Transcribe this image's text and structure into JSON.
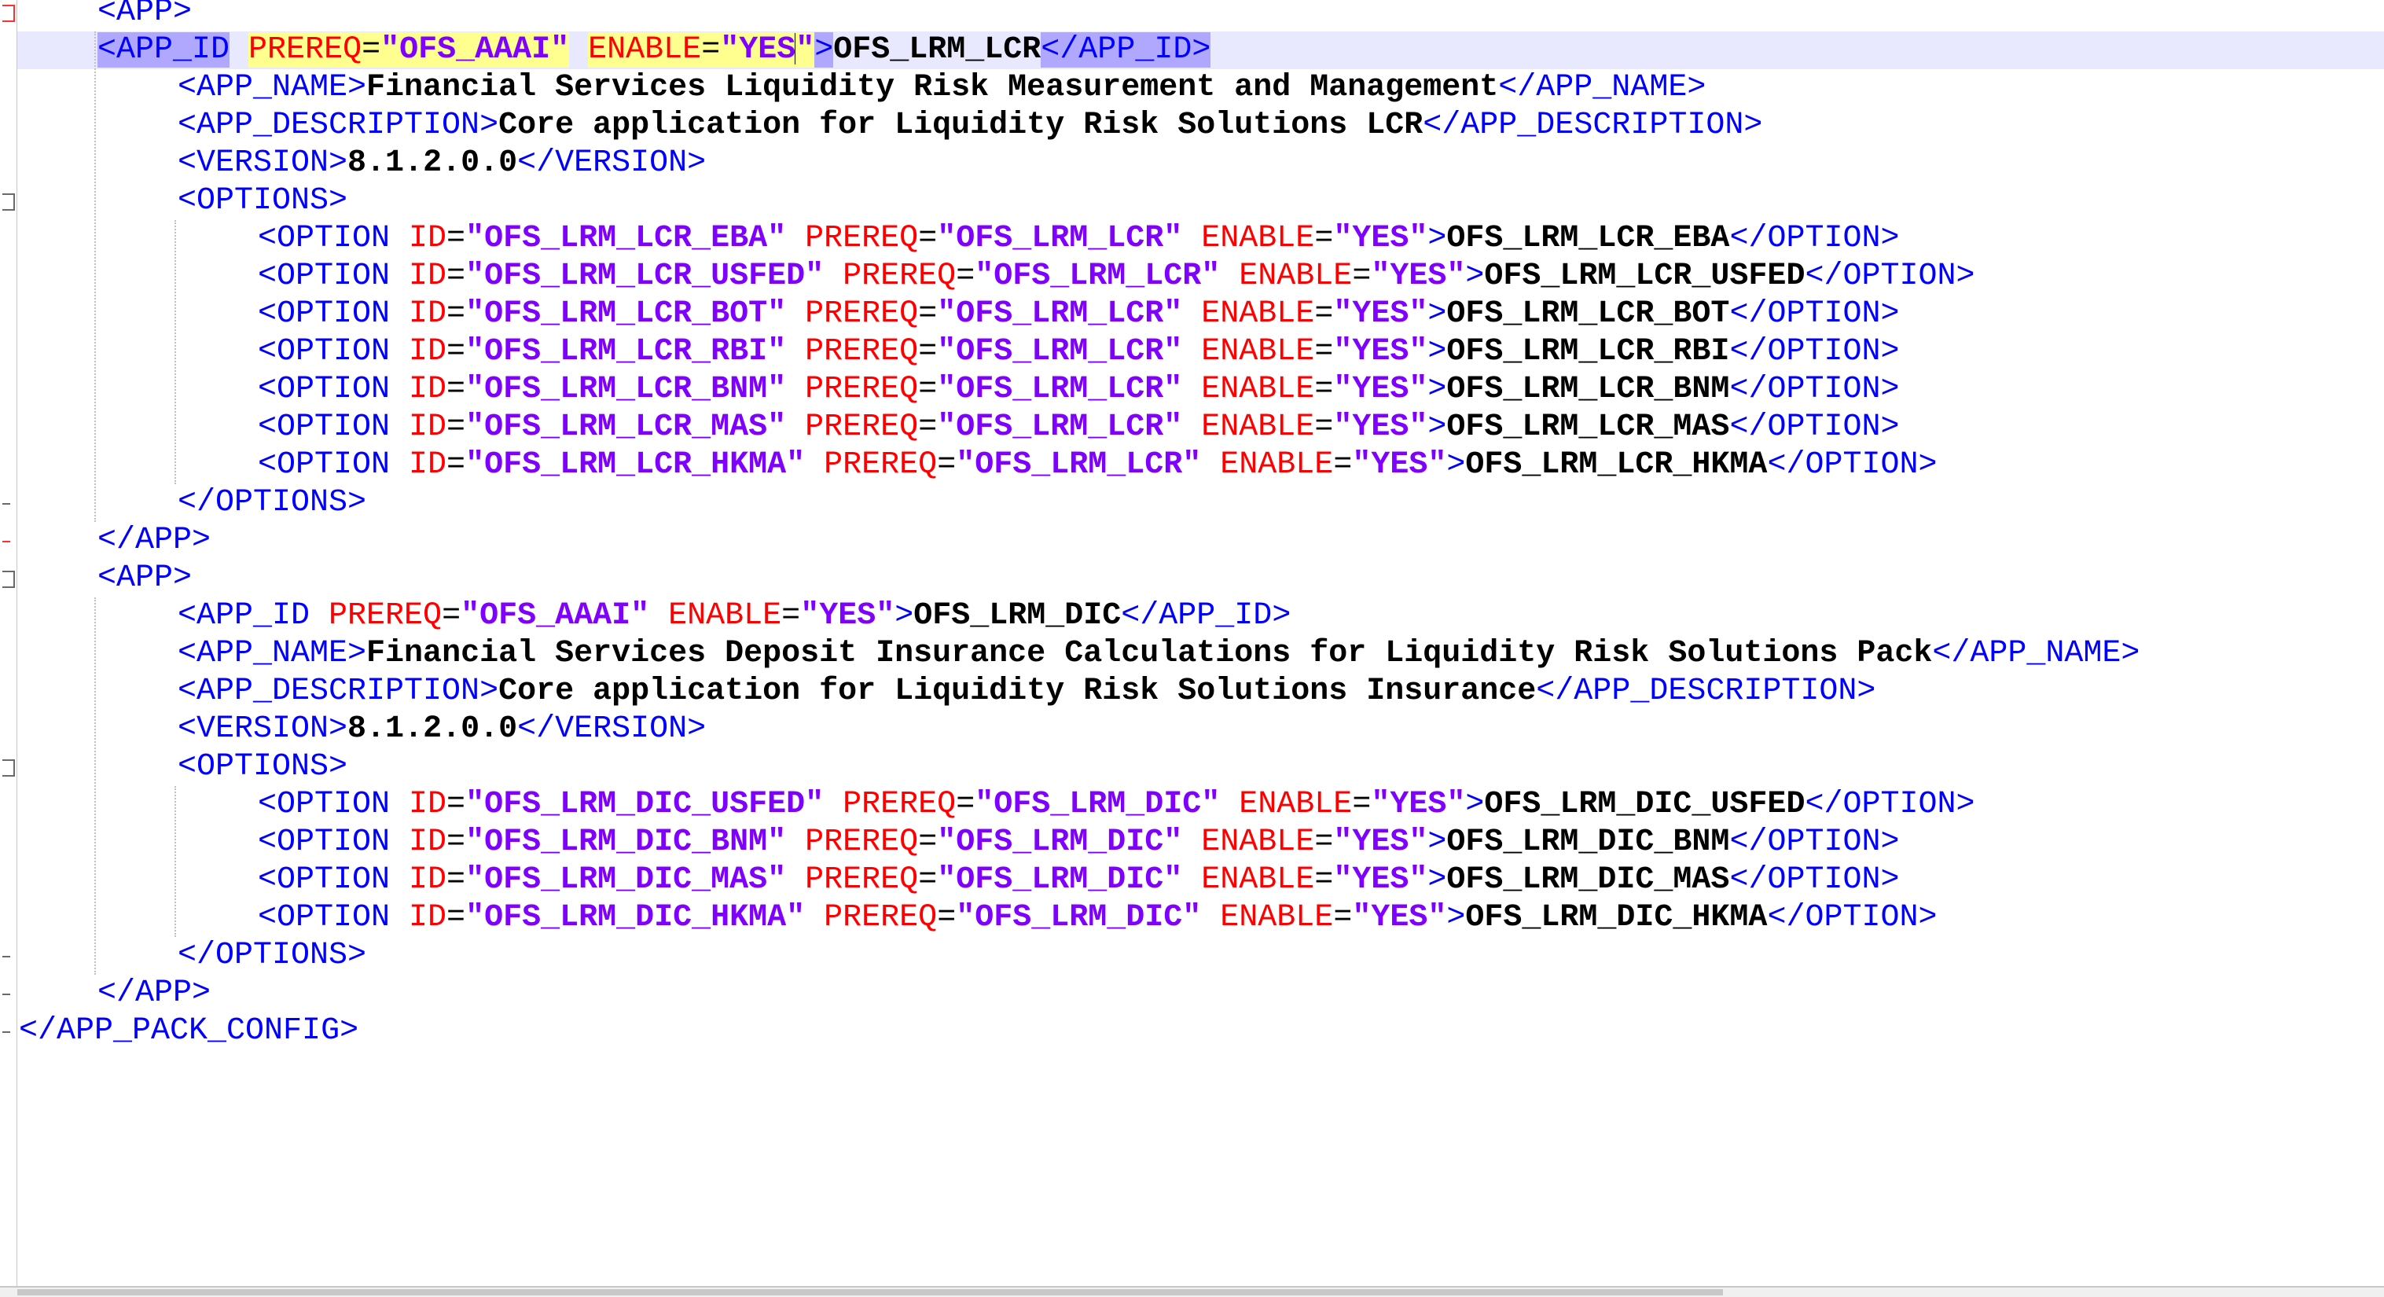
{
  "editor": {
    "lines": [
      [
        {
          "t": "<APP>",
          "c": "tag"
        }
      ],
      [
        {
          "t": "<APP_ID",
          "c": "tag hl-match"
        },
        {
          "t": " ",
          "c": "tag"
        },
        {
          "t": "PREREQ",
          "c": "attr hl-attr"
        },
        {
          "t": "=",
          "c": "eq hl-attr"
        },
        {
          "t": "\"OFS_AAAI\"",
          "c": "val hl-attr"
        },
        {
          "t": " ",
          "c": "tag"
        },
        {
          "t": "ENABLE",
          "c": "attr hl-attr"
        },
        {
          "t": "=",
          "c": "eq hl-attr"
        },
        {
          "t": "\"YES",
          "c": "val hl-attr"
        },
        {
          "caret": true
        },
        {
          "t": "\"",
          "c": "val hl-attr"
        },
        {
          "t": ">",
          "c": "tag hl-match"
        },
        {
          "t": "OFS_LRM_LCR",
          "c": "content"
        },
        {
          "t": "</APP_ID>",
          "c": "tag hl-match"
        }
      ],
      [
        {
          "t": "<APP_NAME>",
          "c": "tag"
        },
        {
          "t": "Financial Services Liquidity Risk Measurement and Management",
          "c": "content"
        },
        {
          "t": "</APP_NAME>",
          "c": "tag"
        }
      ],
      [
        {
          "t": "<APP_DESCRIPTION>",
          "c": "tag"
        },
        {
          "t": "Core application for Liquidity Risk Solutions LCR",
          "c": "content"
        },
        {
          "t": "</APP_DESCRIPTION>",
          "c": "tag"
        }
      ],
      [
        {
          "t": "<VERSION>",
          "c": "tag"
        },
        {
          "t": "8.1.2.0.0",
          "c": "content"
        },
        {
          "t": "</VERSION>",
          "c": "tag"
        }
      ],
      [
        {
          "t": "<OPTIONS>",
          "c": "tag"
        }
      ],
      [
        {
          "t": "<OPTION ",
          "c": "tag"
        },
        {
          "t": "ID",
          "c": "attr"
        },
        {
          "t": "=",
          "c": "eq"
        },
        {
          "t": "\"OFS_LRM_LCR_EBA\"",
          "c": "val"
        },
        {
          "t": " ",
          "c": "tag"
        },
        {
          "t": "PREREQ",
          "c": "attr"
        },
        {
          "t": "=",
          "c": "eq"
        },
        {
          "t": "\"OFS_LRM_LCR\"",
          "c": "val"
        },
        {
          "t": " ",
          "c": "tag"
        },
        {
          "t": "ENABLE",
          "c": "attr"
        },
        {
          "t": "=",
          "c": "eq"
        },
        {
          "t": "\"YES\"",
          "c": "val"
        },
        {
          "t": ">",
          "c": "tag"
        },
        {
          "t": "OFS_LRM_LCR_EBA",
          "c": "content"
        },
        {
          "t": "</OPTION>",
          "c": "tag"
        }
      ],
      [
        {
          "t": "<OPTION ",
          "c": "tag"
        },
        {
          "t": "ID",
          "c": "attr"
        },
        {
          "t": "=",
          "c": "eq"
        },
        {
          "t": "\"OFS_LRM_LCR_USFED\"",
          "c": "val"
        },
        {
          "t": " ",
          "c": "tag"
        },
        {
          "t": "PREREQ",
          "c": "attr"
        },
        {
          "t": "=",
          "c": "eq"
        },
        {
          "t": "\"OFS_LRM_LCR\"",
          "c": "val"
        },
        {
          "t": " ",
          "c": "tag"
        },
        {
          "t": "ENABLE",
          "c": "attr"
        },
        {
          "t": "=",
          "c": "eq"
        },
        {
          "t": "\"YES\"",
          "c": "val"
        },
        {
          "t": ">",
          "c": "tag"
        },
        {
          "t": "OFS_LRM_LCR_USFED",
          "c": "content"
        },
        {
          "t": "</OPTION>",
          "c": "tag"
        }
      ],
      [
        {
          "t": "<OPTION ",
          "c": "tag"
        },
        {
          "t": "ID",
          "c": "attr"
        },
        {
          "t": "=",
          "c": "eq"
        },
        {
          "t": "\"OFS_LRM_LCR_BOT\"",
          "c": "val"
        },
        {
          "t": " ",
          "c": "tag"
        },
        {
          "t": "PREREQ",
          "c": "attr"
        },
        {
          "t": "=",
          "c": "eq"
        },
        {
          "t": "\"OFS_LRM_LCR\"",
          "c": "val"
        },
        {
          "t": " ",
          "c": "tag"
        },
        {
          "t": "ENABLE",
          "c": "attr"
        },
        {
          "t": "=",
          "c": "eq"
        },
        {
          "t": "\"YES\"",
          "c": "val"
        },
        {
          "t": ">",
          "c": "tag"
        },
        {
          "t": "OFS_LRM_LCR_BOT",
          "c": "content"
        },
        {
          "t": "</OPTION>",
          "c": "tag"
        }
      ],
      [
        {
          "t": "<OPTION ",
          "c": "tag"
        },
        {
          "t": "ID",
          "c": "attr"
        },
        {
          "t": "=",
          "c": "eq"
        },
        {
          "t": "\"OFS_LRM_LCR_RBI\"",
          "c": "val"
        },
        {
          "t": " ",
          "c": "tag"
        },
        {
          "t": "PREREQ",
          "c": "attr"
        },
        {
          "t": "=",
          "c": "eq"
        },
        {
          "t": "\"OFS_LRM_LCR\"",
          "c": "val"
        },
        {
          "t": " ",
          "c": "tag"
        },
        {
          "t": "ENABLE",
          "c": "attr"
        },
        {
          "t": "=",
          "c": "eq"
        },
        {
          "t": "\"YES\"",
          "c": "val"
        },
        {
          "t": ">",
          "c": "tag"
        },
        {
          "t": "OFS_LRM_LCR_RBI",
          "c": "content"
        },
        {
          "t": "</OPTION>",
          "c": "tag"
        }
      ],
      [
        {
          "t": "<OPTION ",
          "c": "tag"
        },
        {
          "t": "ID",
          "c": "attr"
        },
        {
          "t": "=",
          "c": "eq"
        },
        {
          "t": "\"OFS_LRM_LCR_BNM\"",
          "c": "val"
        },
        {
          "t": " ",
          "c": "tag"
        },
        {
          "t": "PREREQ",
          "c": "attr"
        },
        {
          "t": "=",
          "c": "eq"
        },
        {
          "t": "\"OFS_LRM_LCR\"",
          "c": "val"
        },
        {
          "t": " ",
          "c": "tag"
        },
        {
          "t": "ENABLE",
          "c": "attr"
        },
        {
          "t": "=",
          "c": "eq"
        },
        {
          "t": "\"YES\"",
          "c": "val"
        },
        {
          "t": ">",
          "c": "tag"
        },
        {
          "t": "OFS_LRM_LCR_BNM",
          "c": "content"
        },
        {
          "t": "</OPTION>",
          "c": "tag"
        }
      ],
      [
        {
          "t": "<OPTION ",
          "c": "tag"
        },
        {
          "t": "ID",
          "c": "attr"
        },
        {
          "t": "=",
          "c": "eq"
        },
        {
          "t": "\"OFS_LRM_LCR_MAS\"",
          "c": "val"
        },
        {
          "t": " ",
          "c": "tag"
        },
        {
          "t": "PREREQ",
          "c": "attr"
        },
        {
          "t": "=",
          "c": "eq"
        },
        {
          "t": "\"OFS_LRM_LCR\"",
          "c": "val"
        },
        {
          "t": " ",
          "c": "tag"
        },
        {
          "t": "ENABLE",
          "c": "attr"
        },
        {
          "t": "=",
          "c": "eq"
        },
        {
          "t": "\"YES\"",
          "c": "val"
        },
        {
          "t": ">",
          "c": "tag"
        },
        {
          "t": "OFS_LRM_LCR_MAS",
          "c": "content"
        },
        {
          "t": "</OPTION>",
          "c": "tag"
        }
      ],
      [
        {
          "t": "<OPTION ",
          "c": "tag"
        },
        {
          "t": "ID",
          "c": "attr"
        },
        {
          "t": "=",
          "c": "eq"
        },
        {
          "t": "\"OFS_LRM_LCR_HKMA\"",
          "c": "val"
        },
        {
          "t": " ",
          "c": "tag"
        },
        {
          "t": "PREREQ",
          "c": "attr"
        },
        {
          "t": "=",
          "c": "eq"
        },
        {
          "t": "\"OFS_LRM_LCR\"",
          "c": "val"
        },
        {
          "t": " ",
          "c": "tag"
        },
        {
          "t": "ENABLE",
          "c": "attr"
        },
        {
          "t": "=",
          "c": "eq"
        },
        {
          "t": "\"YES\"",
          "c": "val"
        },
        {
          "t": ">",
          "c": "tag"
        },
        {
          "t": "OFS_LRM_LCR_HKMA",
          "c": "content"
        },
        {
          "t": "</OPTION>",
          "c": "tag"
        }
      ],
      [
        {
          "t": "</OPTIONS>",
          "c": "tag"
        }
      ],
      [
        {
          "t": "</APP>",
          "c": "tag"
        }
      ],
      [
        {
          "t": "<APP>",
          "c": "tag"
        }
      ],
      [
        {
          "t": "<APP_ID ",
          "c": "tag"
        },
        {
          "t": "PREREQ",
          "c": "attr"
        },
        {
          "t": "=",
          "c": "eq"
        },
        {
          "t": "\"OFS_AAAI\"",
          "c": "val"
        },
        {
          "t": " ",
          "c": "tag"
        },
        {
          "t": "ENABLE",
          "c": "attr"
        },
        {
          "t": "=",
          "c": "eq"
        },
        {
          "t": "\"YES\"",
          "c": "val"
        },
        {
          "t": ">",
          "c": "tag"
        },
        {
          "t": "OFS_LRM_DIC",
          "c": "content"
        },
        {
          "t": "</APP_ID>",
          "c": "tag"
        }
      ],
      [
        {
          "t": "<APP_NAME>",
          "c": "tag"
        },
        {
          "t": "Financial Services Deposit Insurance Calculations for Liquidity Risk Solutions Pack",
          "c": "content"
        },
        {
          "t": "</APP_NAME>",
          "c": "tag"
        }
      ],
      [
        {
          "t": "<APP_DESCRIPTION>",
          "c": "tag"
        },
        {
          "t": "Core application for Liquidity Risk Solutions Insurance",
          "c": "content"
        },
        {
          "t": "</APP_DESCRIPTION>",
          "c": "tag"
        }
      ],
      [
        {
          "t": "<VERSION>",
          "c": "tag"
        },
        {
          "t": "8.1.2.0.0",
          "c": "content"
        },
        {
          "t": "</VERSION>",
          "c": "tag"
        }
      ],
      [
        {
          "t": "<OPTIONS>",
          "c": "tag"
        }
      ],
      [
        {
          "t": "<OPTION ",
          "c": "tag"
        },
        {
          "t": "ID",
          "c": "attr"
        },
        {
          "t": "=",
          "c": "eq"
        },
        {
          "t": "\"OFS_LRM_DIC_USFED\"",
          "c": "val"
        },
        {
          "t": " ",
          "c": "tag"
        },
        {
          "t": "PREREQ",
          "c": "attr"
        },
        {
          "t": "=",
          "c": "eq"
        },
        {
          "t": "\"OFS_LRM_DIC\"",
          "c": "val"
        },
        {
          "t": " ",
          "c": "tag"
        },
        {
          "t": "ENABLE",
          "c": "attr"
        },
        {
          "t": "=",
          "c": "eq"
        },
        {
          "t": "\"YES\"",
          "c": "val"
        },
        {
          "t": ">",
          "c": "tag"
        },
        {
          "t": "OFS_LRM_DIC_USFED",
          "c": "content"
        },
        {
          "t": "</OPTION>",
          "c": "tag"
        }
      ],
      [
        {
          "t": "<OPTION ",
          "c": "tag"
        },
        {
          "t": "ID",
          "c": "attr"
        },
        {
          "t": "=",
          "c": "eq"
        },
        {
          "t": "\"OFS_LRM_DIC_BNM\"",
          "c": "val"
        },
        {
          "t": " ",
          "c": "tag"
        },
        {
          "t": "PREREQ",
          "c": "attr"
        },
        {
          "t": "=",
          "c": "eq"
        },
        {
          "t": "\"OFS_LRM_DIC\"",
          "c": "val"
        },
        {
          "t": " ",
          "c": "tag"
        },
        {
          "t": "ENABLE",
          "c": "attr"
        },
        {
          "t": "=",
          "c": "eq"
        },
        {
          "t": "\"YES\"",
          "c": "val"
        },
        {
          "t": ">",
          "c": "tag"
        },
        {
          "t": "OFS_LRM_DIC_BNM",
          "c": "content"
        },
        {
          "t": "</OPTION>",
          "c": "tag"
        }
      ],
      [
        {
          "t": "<OPTION ",
          "c": "tag"
        },
        {
          "t": "ID",
          "c": "attr"
        },
        {
          "t": "=",
          "c": "eq"
        },
        {
          "t": "\"OFS_LRM_DIC_MAS\"",
          "c": "val"
        },
        {
          "t": " ",
          "c": "tag"
        },
        {
          "t": "PREREQ",
          "c": "attr"
        },
        {
          "t": "=",
          "c": "eq"
        },
        {
          "t": "\"OFS_LRM_DIC\"",
          "c": "val"
        },
        {
          "t": " ",
          "c": "tag"
        },
        {
          "t": "ENABLE",
          "c": "attr"
        },
        {
          "t": "=",
          "c": "eq"
        },
        {
          "t": "\"YES\"",
          "c": "val"
        },
        {
          "t": ">",
          "c": "tag"
        },
        {
          "t": "OFS_LRM_DIC_MAS",
          "c": "content"
        },
        {
          "t": "</OPTION>",
          "c": "tag"
        }
      ],
      [
        {
          "t": "<OPTION ",
          "c": "tag"
        },
        {
          "t": "ID",
          "c": "attr"
        },
        {
          "t": "=",
          "c": "eq"
        },
        {
          "t": "\"OFS_LRM_DIC_HKMA\"",
          "c": "val"
        },
        {
          "t": " ",
          "c": "tag"
        },
        {
          "t": "PREREQ",
          "c": "attr"
        },
        {
          "t": "=",
          "c": "eq"
        },
        {
          "t": "\"OFS_LRM_DIC\"",
          "c": "val"
        },
        {
          "t": " ",
          "c": "tag"
        },
        {
          "t": "ENABLE",
          "c": "attr"
        },
        {
          "t": "=",
          "c": "eq"
        },
        {
          "t": "\"YES\"",
          "c": "val"
        },
        {
          "t": ">",
          "c": "tag"
        },
        {
          "t": "OFS_LRM_DIC_HKMA",
          "c": "content"
        },
        {
          "t": "</OPTION>",
          "c": "tag"
        }
      ],
      [
        {
          "t": "</OPTIONS>",
          "c": "tag"
        }
      ],
      [
        {
          "t": "</APP>",
          "c": "tag"
        }
      ],
      [
        {
          "t": "</APP_PACK_CONFIG>",
          "c": "tag"
        }
      ]
    ]
  },
  "syntax_colors": {
    "tag": "#0000ff",
    "attribute": "#ff0000",
    "attribute_value": "#8000ff",
    "text": "#000000",
    "current_line": "#e8e8ff",
    "brace_match": "#b0a8ff",
    "attribute_highlight": "#ffff90"
  },
  "fold_markers": [
    "fold-box-icon",
    "fold-end-icon"
  ]
}
